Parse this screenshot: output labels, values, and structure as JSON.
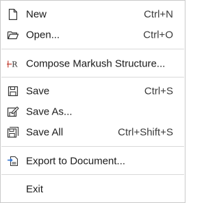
{
  "menu": {
    "items": [
      {
        "key": "new",
        "label": "New",
        "shortcut": "Ctrl+N",
        "icon": "new-document-icon"
      },
      {
        "key": "open",
        "label": "Open...",
        "shortcut": "Ctrl+O",
        "icon": "open-folder-icon"
      },
      {
        "key": "markush",
        "label": "Compose Markush Structure...",
        "shortcut": "",
        "icon": "markush-icon"
      },
      {
        "key": "save",
        "label": "Save",
        "shortcut": "Ctrl+S",
        "icon": "save-icon"
      },
      {
        "key": "saveas",
        "label": "Save As...",
        "shortcut": "",
        "icon": "save-as-icon"
      },
      {
        "key": "saveall",
        "label": "Save All",
        "shortcut": "Ctrl+Shift+S",
        "icon": "save-all-icon"
      },
      {
        "key": "export",
        "label": "Export to Document...",
        "shortcut": "",
        "icon": "export-document-icon"
      },
      {
        "key": "exit",
        "label": "Exit",
        "shortcut": "",
        "icon": ""
      }
    ]
  },
  "colors": {
    "text": "#1a1a1a",
    "separator": "#d9d9d9",
    "border": "#c9c9c9",
    "markush_accent": "#c0392b",
    "export_accent": "#2a6fcf"
  }
}
